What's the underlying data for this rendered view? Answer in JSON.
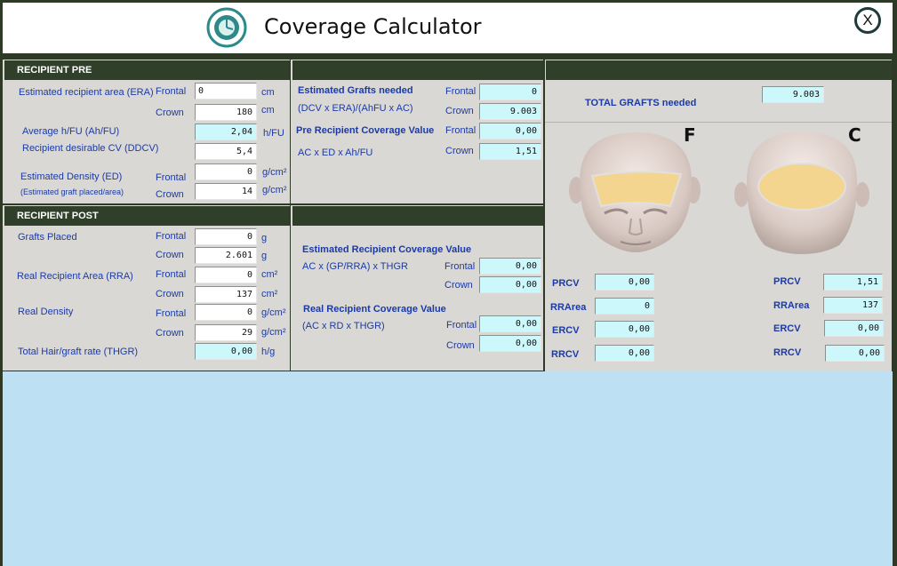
{
  "app": {
    "title": "Coverage Calculator",
    "close_label": "X"
  },
  "recipient_pre": {
    "header": "RECIPIENT PRE",
    "era_label": "Estimated recipient area (ERA)",
    "frontal": "Frontal",
    "crown": "Crown",
    "era_frontal": "0",
    "era_crown": "180",
    "unit_cm": "cm",
    "ahfu_label": "Average h/FU (Ah/FU)",
    "ahfu_value": "2,04",
    "ahfu_unit": "h/FU",
    "ddcv_label": "Recipient desirable CV (DDCV)",
    "ddcv_value": "5,4",
    "ed_label": "Estimated Density (ED)",
    "ed_sub": "(Estimated graft placed/area)",
    "ed_frontal": "0",
    "ed_crown": "14",
    "unit_gcm": "g/cm²"
  },
  "estimated": {
    "grafts_label": "Estimated Grafts needed",
    "formula": "(DCV x ERA)/(AhFU x AC)",
    "grafts_frontal": "0",
    "grafts_crown": "9.003",
    "precv_label": "Pre Recipient Coverage Value",
    "precv_formula": "AC x ED x Ah/FU",
    "precv_frontal": "0,00",
    "precv_crown": "1,51"
  },
  "recipient_post": {
    "header": "RECIPIENT POST",
    "gp_label": "Grafts Placed",
    "gp_frontal": "0",
    "gp_crown": "2.601",
    "unit_g": "g",
    "rra_label": "Real Recipient Area (RRA)",
    "rra_frontal": "0",
    "rra_crown": "137",
    "unit_cm2": "cm²",
    "rd_label": "Real Density",
    "rd_frontal": "0",
    "rd_crown": "29",
    "thgr_label": "Total Hair/graft rate (THGR)",
    "thgr_value": "0,00",
    "unit_hg": "h/g"
  },
  "post_calc": {
    "ercv_label": "Estimated Recipient Coverage Value",
    "ercv_formula": "AC x (GP/RRA) x THGR",
    "ercv_frontal": "0,00",
    "ercv_crown": "0,00",
    "rrcv_label": "Real Recipient Coverage Value",
    "rrcv_formula": "(AC x RD x THGR)",
    "rrcv_frontal": "0,00",
    "rrcv_crown": "0,00"
  },
  "totals": {
    "label": "TOTAL GRAFTS needed",
    "value": "9.003",
    "letter_f": "F",
    "letter_c": "C"
  },
  "summary": {
    "prcv": "PRCV",
    "rrarea": "RRArea",
    "ercv": "ERCV",
    "rrcv": "RRCV",
    "f_prcv": "0,00",
    "f_rrarea": "0",
    "f_ercv": "0,00",
    "f_rrcv": "0,00",
    "c_prcv": "1,51",
    "c_rrarea": "137",
    "c_ercv": "0,00",
    "c_rrcv": "0,00"
  },
  "colors": {
    "header_bg": "#2f3f29",
    "label": "#1b3aa7",
    "cyan_field": "#ccf7fb",
    "lower_bg": "#bee0f3"
  },
  "icons": {
    "logo": "clock-globe-logo",
    "close": "close-icon"
  }
}
